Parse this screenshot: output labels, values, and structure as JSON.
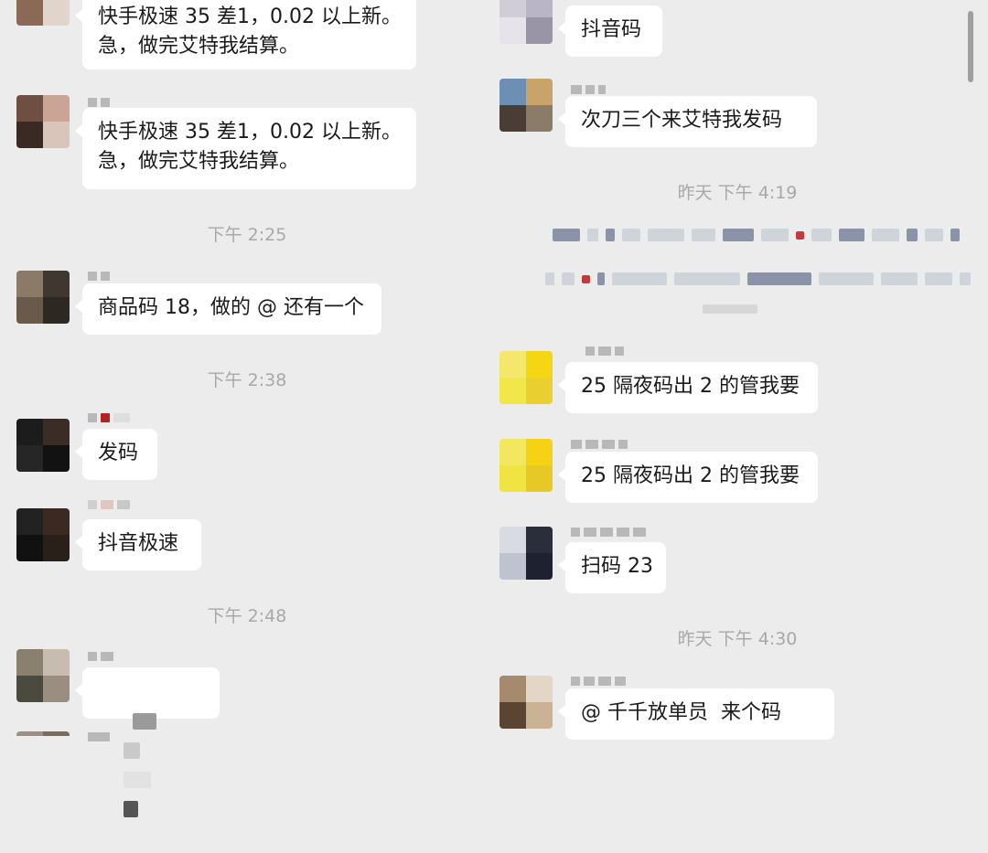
{
  "left_column": {
    "messages": [
      {
        "text": "快手极速 35 差1，0.02 以上新。\n急，做完艾特我结算。"
      },
      {
        "text": "快手极速 35 差1，0.02 以上新。\n急，做完艾特我结算。"
      },
      {
        "text": "商品码 18，做的 @ 还有一个"
      },
      {
        "text": "发码"
      },
      {
        "text": "抖音极速"
      }
    ],
    "timestamps": [
      "下午 2:25",
      "下午 2:38",
      "下午 2:48"
    ]
  },
  "right_column": {
    "messages": [
      {
        "text": "抖音码"
      },
      {
        "text": "次刀三个来艾特我发码"
      },
      {
        "text": "25 隔夜码出 2 的管我要"
      },
      {
        "text": "25 隔夜码出 2 的管我要"
      },
      {
        "text": "扫码 23"
      },
      {
        "text": "@ 千千放单员  来个码"
      }
    ],
    "timestamps": [
      "昨天 下午 4:19",
      "昨天 下午 4:30"
    ]
  },
  "colors": {
    "background": "#ececec",
    "bubble": "#ffffff",
    "timestamp": "#a8a8a8",
    "text": "#1a1a1a"
  }
}
